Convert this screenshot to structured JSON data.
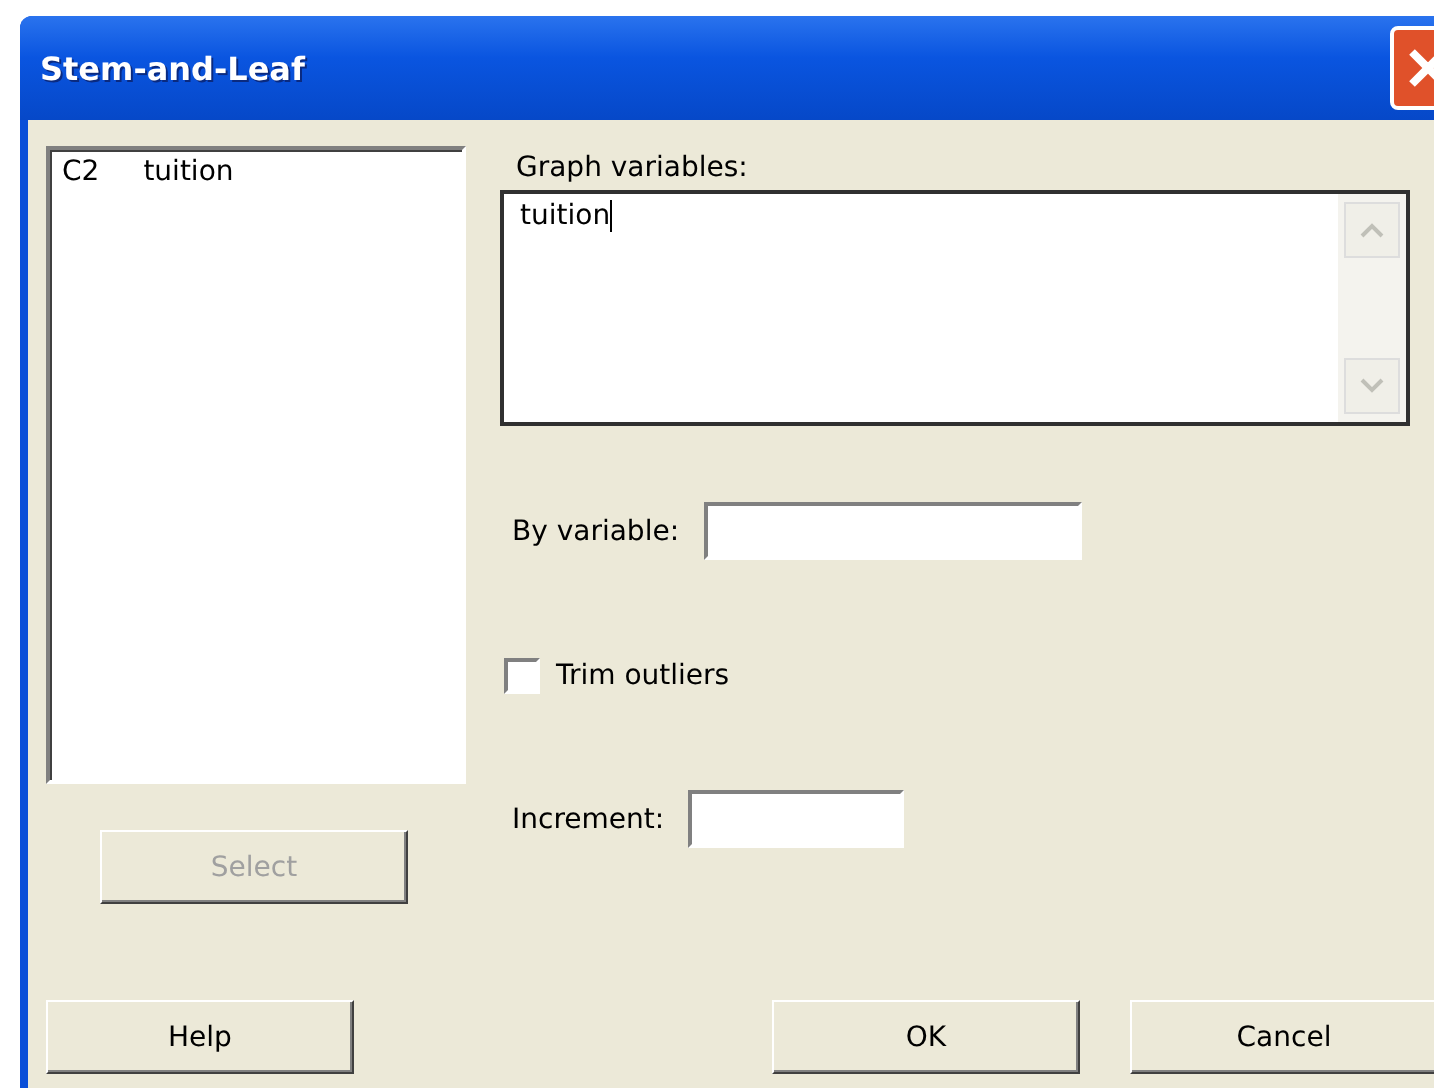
{
  "window": {
    "title": "Stem-and-Leaf"
  },
  "variable_list": [
    {
      "column": "C2",
      "name": "tuition",
      "selected": false
    }
  ],
  "graph_variables": {
    "label": "Graph variables:",
    "value": "tuition"
  },
  "by_variable": {
    "label": "By variable:"
  },
  "trim_outliers": {
    "label": "Trim outliers",
    "checked": false
  },
  "increment": {
    "label": "Increment:"
  },
  "select_button": {
    "label": "Select",
    "disabled": true
  },
  "buttons": [
    {
      "label": "Help"
    },
    {
      "label": "OK"
    },
    {
      "label": "Cancel"
    }
  ]
}
